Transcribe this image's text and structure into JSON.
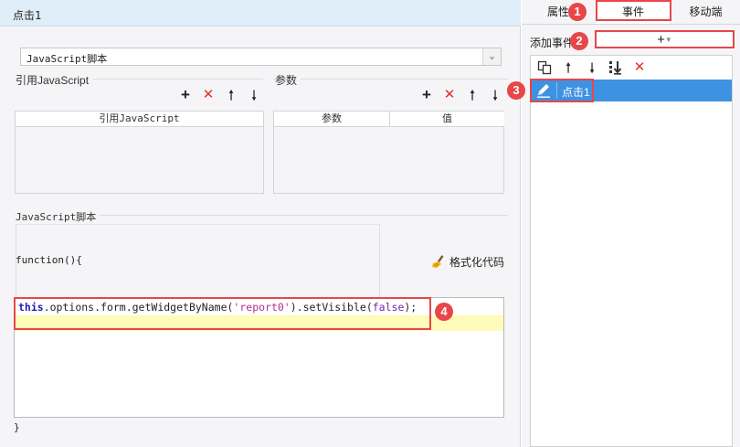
{
  "left_panel": {
    "title": "点击1",
    "script_type_select": {
      "value": "JavaScript脚本"
    },
    "ref_js": {
      "group_label": "引用JavaScript",
      "column_header": "引用JavaScript"
    },
    "params": {
      "group_label": "参数",
      "columns": [
        "参数",
        "值"
      ]
    },
    "toolbar_icons": [
      "plus-icon",
      "delete-icon",
      "arrow-up-icon",
      "arrow-down-icon"
    ],
    "js_section": {
      "group_label": "JavaScript脚本",
      "function_header": "function(){",
      "format_button_label": "格式化代码",
      "code": {
        "kw_this": "this",
        "mid": ".options.form.getWidgetByName(",
        "str_arg": "'report0'",
        "mid2": ").setVisible(",
        "bool_arg": "false",
        "end": ");"
      },
      "closing_brace": "}"
    }
  },
  "right_panel": {
    "tabs": [
      "属性",
      "事件",
      "移动端"
    ],
    "active_tab": "事件",
    "add_event_label": "添加事件",
    "add_event_symbol": "+",
    "event_toolbar_icons": [
      "copy-icon",
      "move-up-icon",
      "move-down-icon",
      "move-bottom-icon",
      "delete-icon"
    ],
    "events": [
      {
        "label": "点击1",
        "selected": true
      }
    ]
  },
  "callouts": [
    "1",
    "2",
    "3",
    "4"
  ],
  "colors": {
    "accent_red": "#e8464a",
    "selection_blue": "#3d92e1",
    "title_bar": "#dfedf8",
    "current_line": "#fffbb8"
  }
}
